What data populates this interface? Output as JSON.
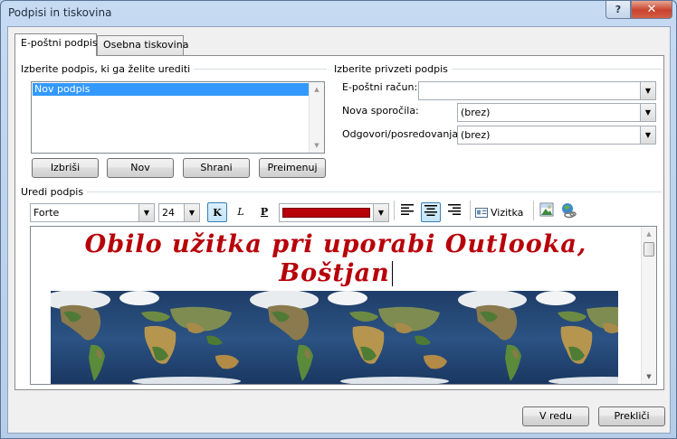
{
  "window": {
    "title": "Podpisi in tiskovina",
    "help_label": "?",
    "close_label": "✕"
  },
  "tabs": [
    {
      "label": "E-poštni podpis",
      "active": true
    },
    {
      "label": "Osebna tiskovina",
      "active": false
    }
  ],
  "edit_section": {
    "label": "Izberite podpis, ki ga želite urediti",
    "signatures": [
      "Nov podpis"
    ],
    "selected": "Nov podpis"
  },
  "sig_buttons": {
    "delete": "Izbriši",
    "new": "Nov",
    "save": "Shrani",
    "rename": "Preimenuj"
  },
  "default_section": {
    "label": "Izberite privzeti podpis",
    "email_account_label": "E-poštni račun:",
    "email_account_value": "",
    "new_messages_label": "Nova sporočila:",
    "new_messages_value": "(brez)",
    "replies_label": "Odgovori/posredovanja:",
    "replies_value": "(brez)"
  },
  "editor": {
    "label": "Uredi podpis",
    "font": "Forte",
    "size": "24",
    "bold_label": "K",
    "italic_label": "L",
    "underline_label": "P",
    "font_color": "#b70009",
    "business_card_label": "Vizitka",
    "signature_line1": "Obilo užitka pri uporabi Outlooka,",
    "signature_line2": "Boštjan"
  },
  "footer": {
    "ok": "V redu",
    "cancel": "Prekliči"
  },
  "colors": {
    "selection": "#3399ff",
    "signature_text": "#b70009",
    "close_button": "#c8432d"
  }
}
